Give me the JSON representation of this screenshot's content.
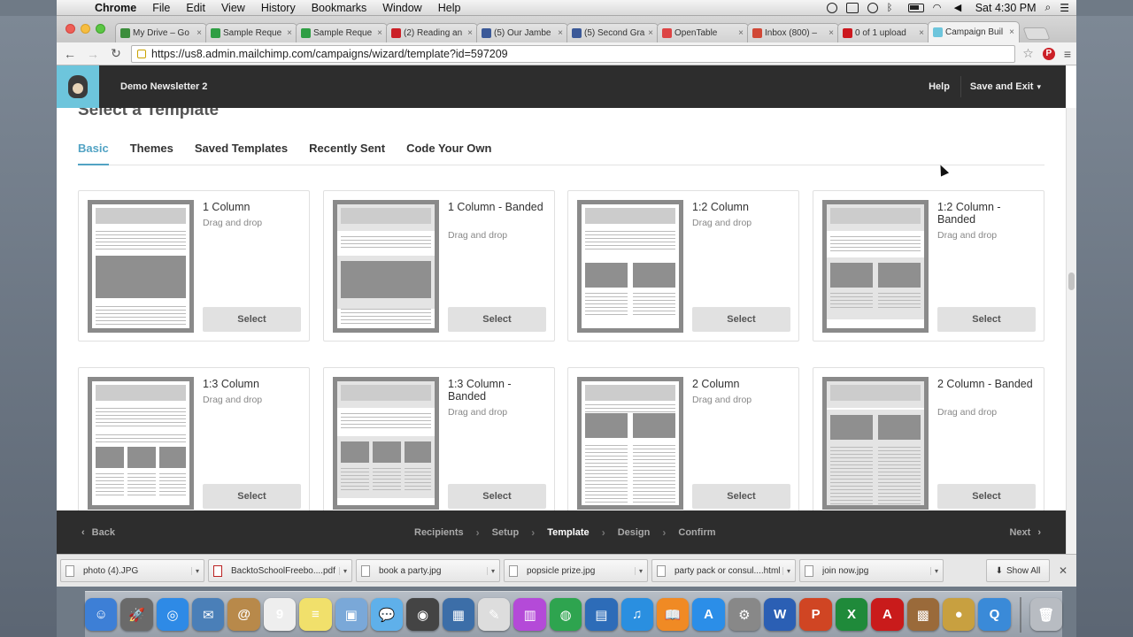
{
  "menubar": {
    "app": "Chrome",
    "items": [
      "File",
      "Edit",
      "View",
      "History",
      "Bookmarks",
      "Window",
      "Help"
    ],
    "clock": "Sat 4:30 PM"
  },
  "tabs": [
    {
      "label": "My Drive – Go",
      "color": "#3b8d3b"
    },
    {
      "label": "Sample Reque",
      "color": "#2f9e44"
    },
    {
      "label": "Sample Reque",
      "color": "#2f9e44"
    },
    {
      "label": "(2) Reading an",
      "color": "#cb2027"
    },
    {
      "label": "(5) Our Jambe",
      "color": "#3b5998"
    },
    {
      "label": "(5) Second Gra",
      "color": "#3b5998"
    },
    {
      "label": "OpenTable",
      "color": "#d44"
    },
    {
      "label": "Inbox (800) –",
      "color": "#d14836"
    },
    {
      "label": "0 of 1 upload",
      "color": "#cc181e"
    },
    {
      "label": "Campaign Buil",
      "color": "#6dc5dc"
    }
  ],
  "toolbar": {
    "url": "https://us8.admin.mailchimp.com/campaigns/wizard/template?id=597209"
  },
  "header": {
    "campaign": "Demo Newsletter 2",
    "help": "Help",
    "save_exit": "Save and Exit"
  },
  "page": {
    "title": "Select a Template",
    "nav": [
      "Basic",
      "Themes",
      "Saved Templates",
      "Recently Sent",
      "Code Your Own"
    ],
    "active_nav": "Basic"
  },
  "templates": [
    {
      "name": "1 Column",
      "sub": "Drag and drop",
      "select": "Select"
    },
    {
      "name": "1 Column - Banded",
      "sub": "Drag and drop",
      "select": "Select"
    },
    {
      "name": "1:2 Column",
      "sub": "Drag and drop",
      "select": "Select"
    },
    {
      "name": "1:2 Column - Banded",
      "sub": "Drag and drop",
      "select": "Select"
    },
    {
      "name": "1:3 Column",
      "sub": "Drag and drop",
      "select": "Select"
    },
    {
      "name": "1:3 Column - Banded",
      "sub": "Drag and drop",
      "select": "Select"
    },
    {
      "name": "2 Column",
      "sub": "Drag and drop",
      "select": "Select"
    },
    {
      "name": "2 Column - Banded",
      "sub": "Drag and drop",
      "select": "Select"
    }
  ],
  "footer": {
    "back": "Back",
    "steps": [
      "Recipients",
      "Setup",
      "Template",
      "Design",
      "Confirm"
    ],
    "active_step": "Template",
    "next": "Next"
  },
  "downloads": {
    "files": [
      "photo (4).JPG",
      "BacktoSchoolFreebo....pdf",
      "book a party.jpg",
      "popsicle prize.jpg",
      "party pack or consul....html",
      "join now.jpg"
    ],
    "show_all": "Show All"
  },
  "dock": [
    {
      "name": "finder-icon",
      "color": "#3d7fd6",
      "glyph": "☺"
    },
    {
      "name": "launchpad-icon",
      "color": "#6a6a6a",
      "glyph": "🚀"
    },
    {
      "name": "safari-icon",
      "color": "#2e8ae6",
      "glyph": "◎"
    },
    {
      "name": "mail-bird-icon",
      "color": "#4a7fb8",
      "glyph": "✉"
    },
    {
      "name": "address-book-icon",
      "color": "#b8894a",
      "glyph": "@"
    },
    {
      "name": "calendar-icon",
      "color": "#eeeeee",
      "glyph": "9"
    },
    {
      "name": "stickies-icon",
      "color": "#f1e06b",
      "glyph": "≡"
    },
    {
      "name": "preview-icon",
      "color": "#7aa8d8",
      "glyph": "▣"
    },
    {
      "name": "messages-icon",
      "color": "#5fb0ea",
      "glyph": "💬"
    },
    {
      "name": "facetime-icon",
      "color": "#444444",
      "glyph": "◉"
    },
    {
      "name": "iphoto-icon",
      "color": "#3c6ea8",
      "glyph": "▦"
    },
    {
      "name": "textedit-icon",
      "color": "#dddddd",
      "glyph": "✎"
    },
    {
      "name": "grapher-icon",
      "color": "#b44ad8",
      "glyph": "▥"
    },
    {
      "name": "chrome-icon",
      "color": "#2ea44f",
      "glyph": "◍"
    },
    {
      "name": "keynote-icon",
      "color": "#2d6cb8",
      "glyph": "▤"
    },
    {
      "name": "itunes-icon",
      "color": "#2a8fe0",
      "glyph": "♫"
    },
    {
      "name": "ibooks-icon",
      "color": "#f08a24",
      "glyph": "📖"
    },
    {
      "name": "app-store-icon",
      "color": "#2b8ee8",
      "glyph": "A"
    },
    {
      "name": "system-prefs-icon",
      "color": "#888888",
      "glyph": "⚙"
    },
    {
      "name": "word-icon",
      "color": "#2b5fb4",
      "glyph": "W"
    },
    {
      "name": "powerpoint-icon",
      "color": "#d04523",
      "glyph": "P"
    },
    {
      "name": "excel-icon",
      "color": "#1f8a3a",
      "glyph": "X"
    },
    {
      "name": "acrobat-icon",
      "color": "#c91b1b",
      "glyph": "A"
    },
    {
      "name": "photo-booth-icon",
      "color": "#9a6a3a",
      "glyph": "▩"
    },
    {
      "name": "game-center-icon",
      "color": "#c8a040",
      "glyph": "●"
    },
    {
      "name": "quicktime-icon",
      "color": "#3a8ad8",
      "glyph": "Q"
    },
    {
      "name": "trash-icon",
      "color": "#b8bcc2",
      "glyph": "🗑"
    }
  ]
}
